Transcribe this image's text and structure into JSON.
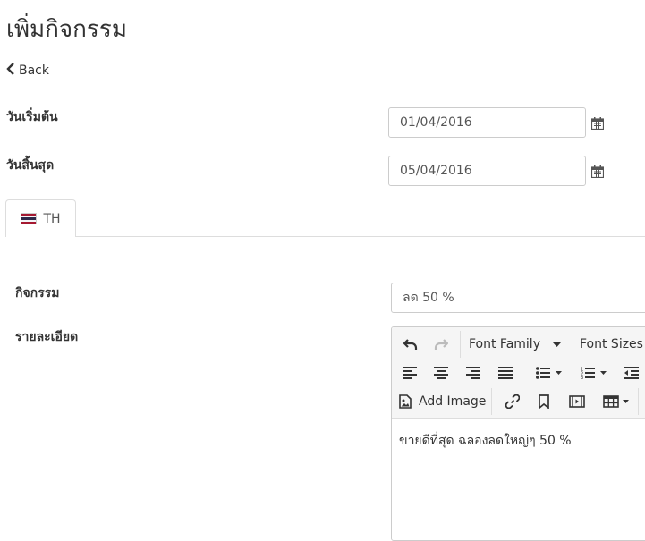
{
  "page": {
    "title": "เพิ่มกิจกรรม",
    "back_label": "Back"
  },
  "form": {
    "start_label": "วันเริ่มต้น",
    "start_value": "01/04/2016",
    "end_label": "วันสิ้นสุด",
    "end_value": "05/04/2016"
  },
  "tabs": [
    {
      "label": "TH",
      "flag": "thailand-flag"
    }
  ],
  "activity": {
    "name_label": "กิจกรรม",
    "name_value": "ลด 50 %",
    "detail_label": "รายละเอียด"
  },
  "editor": {
    "font_family_label": "Font Family",
    "font_sizes_label": "Font Sizes",
    "add_image_label": "Add Image",
    "content": "ขายดีที่สุด ฉลองลดใหญ่ๆ 50 %"
  },
  "colors": {
    "border": "#cccccc",
    "toolbar_bg": "#f5f5f5",
    "text": "#333333",
    "flag_red": "#a51931",
    "flag_white": "#f4f5f8",
    "flag_blue": "#2d2a4a"
  }
}
